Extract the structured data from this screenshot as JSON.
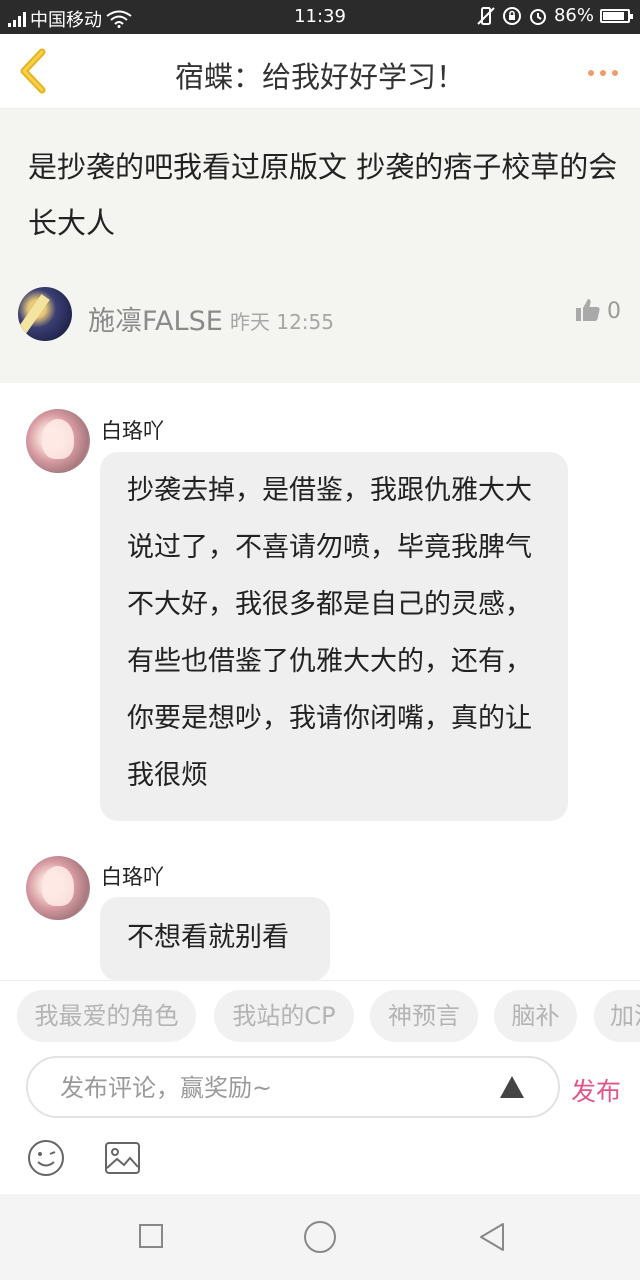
{
  "status_bar": {
    "carrier": "中国移动",
    "time": "11:39",
    "battery": "86%",
    "battery_level": 0.86
  },
  "header": {
    "title": "宿蝶：给我好好学习！"
  },
  "post": {
    "text": "是抄袭的吧我看过原版文 抄袭的痞子校草的会长大人",
    "author": "施凛FALSE",
    "time": "昨天 12:55",
    "likes": "0"
  },
  "replies": [
    {
      "author": "白珞吖",
      "text": "抄袭去掉，是借鉴，我跟仇雅大大说过了，不喜请勿喷，毕竟我脾气不大好，我很多都是自己的灵感，有些也借鉴了仇雅大大的，还有，你要是想吵，我请你闭嘴，真的让我很烦"
    },
    {
      "author": "白珞吖",
      "text": "不想看就别看"
    }
  ],
  "tags": [
    "我最爱的角色",
    "我站的CP",
    "神预言",
    "脑补",
    "加油"
  ],
  "comment_box": {
    "placeholder": "发布评论，赢奖励~",
    "value": "",
    "publish_label": "发布"
  },
  "colors": {
    "publish": "#e2558a",
    "more_dots": "#f29a6b",
    "back_arrow": "#e8b320"
  }
}
